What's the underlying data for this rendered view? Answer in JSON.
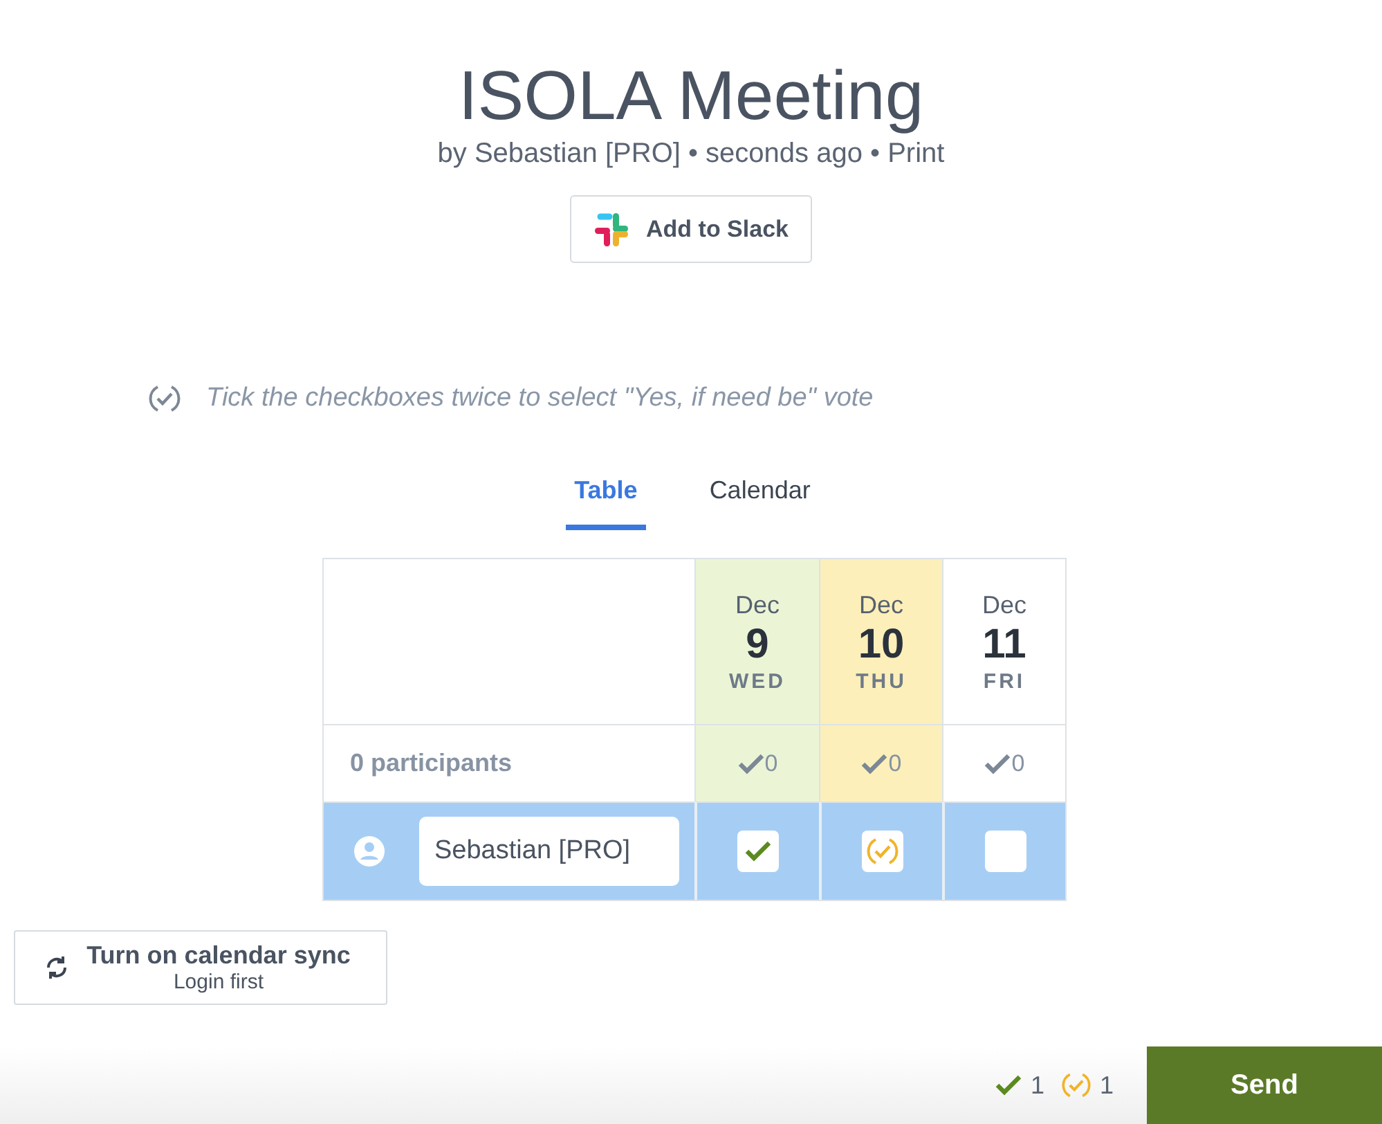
{
  "header": {
    "title": "ISOLA Meeting",
    "byline": "by Sebastian [PRO] • seconds ago • Print",
    "slack_button": "Add to Slack"
  },
  "hint": "Tick the checkboxes twice to select \"Yes, if need be\" vote",
  "tabs": [
    {
      "label": "Table",
      "selected": true
    },
    {
      "label": "Calendar",
      "selected": false
    }
  ],
  "table": {
    "participants": "0 participants",
    "user_name": "Sebastian [PRO]",
    "dates": [
      {
        "month": "Dec",
        "day": "9",
        "weekday": "WED",
        "count": "0",
        "checked": true,
        "if_need_be": false
      },
      {
        "month": "Dec",
        "day": "10",
        "weekday": "THU",
        "count": "0",
        "checked": true,
        "if_need_be": true
      },
      {
        "month": "Dec",
        "day": "11",
        "weekday": "FRI",
        "count": "0",
        "checked": false,
        "if_need_be": false
      }
    ]
  },
  "sync": {
    "title": "Turn on calendar sync",
    "subtitle": "Login first"
  },
  "footer": {
    "yes_count": "1",
    "ifneedbe_count": "1",
    "send_button": "Send"
  }
}
